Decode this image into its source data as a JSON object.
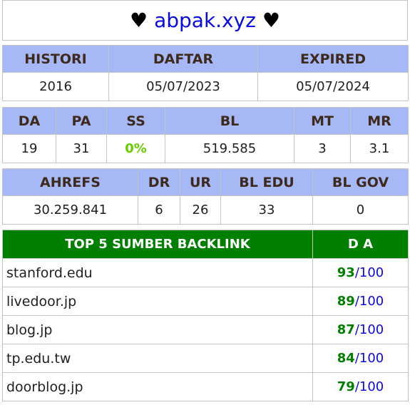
{
  "title": {
    "heart_left": "♥",
    "domain": "abpak.xyz",
    "heart_right": "♥"
  },
  "history": {
    "headers": [
      "HISTORI",
      "DAFTAR",
      "EXPIRED"
    ],
    "values": [
      "2016",
      "05/07/2023",
      "05/07/2024"
    ]
  },
  "metrics1": {
    "headers": [
      "DA",
      "PA",
      "SS",
      "BL",
      "MT",
      "MR"
    ],
    "values": [
      "19",
      "31",
      "0%",
      "519.585",
      "3",
      "3.1"
    ]
  },
  "metrics2": {
    "headers": [
      "AHREFS",
      "DR",
      "UR",
      "BL EDU",
      "BL GOV"
    ],
    "values": [
      "30.259.841",
      "6",
      "26",
      "33",
      "0"
    ]
  },
  "backlinks": {
    "header_source": "TOP 5 SUMBER BACKLINK",
    "header_da": "D A",
    "max": "100",
    "separator": "/",
    "rows": [
      {
        "source": "stanford.edu",
        "da": "93"
      },
      {
        "source": "livedoor.jp",
        "da": "89"
      },
      {
        "source": "blog.jp",
        "da": "87"
      },
      {
        "source": "tp.edu.tw",
        "da": "84"
      },
      {
        "source": "doorblog.jp",
        "da": "79"
      }
    ]
  },
  "colors": {
    "header_bg": "#a6b8f5",
    "backlink_header_bg": "#007f00",
    "ss_green": "#66cc00",
    "link_blue": "#0a0ae6"
  }
}
